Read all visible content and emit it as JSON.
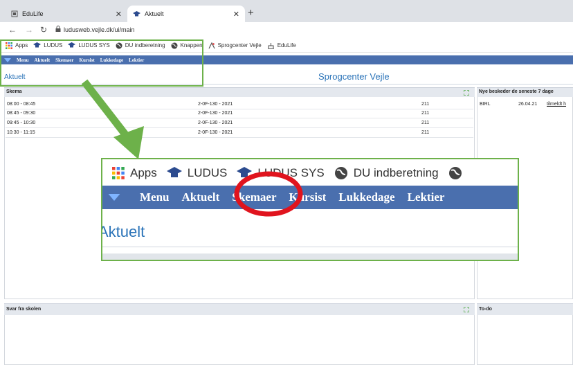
{
  "browser": {
    "tabs": [
      {
        "title": "EduLife",
        "active": false,
        "icon": "page-icon"
      },
      {
        "title": "Aktuelt",
        "active": true,
        "icon": "graduation-cap-icon"
      }
    ],
    "new_tab": "+",
    "url": "ludusweb.vejle.dk/ui/main",
    "bookmarks": [
      {
        "label": "Apps",
        "icon": "apps-grid-icon"
      },
      {
        "label": "LUDUS",
        "icon": "graduation-cap-icon"
      },
      {
        "label": "LUDUS SYS",
        "icon": "graduation-cap-icon"
      },
      {
        "label": "DU indberetning",
        "icon": "globe-icon"
      },
      {
        "label": "Knappen",
        "icon": "globe-icon"
      },
      {
        "label": "Sprogcenter Vejle",
        "icon": "sprogcenter-icon"
      },
      {
        "label": "EduLife",
        "icon": "edulife-icon"
      }
    ]
  },
  "app": {
    "menu": [
      "Menu",
      "Aktuelt",
      "Skemaer",
      "Kursist",
      "Lukkedage",
      "Lektier"
    ],
    "page_title": "Aktuelt",
    "center_title": "Sprogcenter Vejle",
    "schedule": {
      "title": "Skema",
      "rows": [
        {
          "time": "08:00 - 08:45",
          "course": "2-0F-130 - 2021",
          "room": "211"
        },
        {
          "time": "08:45 - 09:30",
          "course": "2-0F-130 - 2021",
          "room": "211"
        },
        {
          "time": "09:45 - 10:30",
          "course": "2-0F-130 - 2021",
          "room": "211"
        },
        {
          "time": "10:30 - 11:15",
          "course": "2-0F-130 - 2021",
          "room": "211"
        }
      ]
    },
    "messages": {
      "title": "Nye beskeder de seneste 7 dage",
      "rows": [
        {
          "from": "BIRL",
          "date": "26.04.21",
          "text": "tilmeldt h"
        }
      ]
    },
    "svar": {
      "title": "Svar fra skolen"
    },
    "todo": {
      "title": "To-do"
    }
  },
  "callout": {
    "bookmarks": [
      {
        "label": "Apps",
        "icon": "apps-grid-icon"
      },
      {
        "label": "LUDUS",
        "icon": "graduation-cap-icon"
      },
      {
        "label": "LUDUS SYS",
        "icon": "graduation-cap-icon"
      },
      {
        "label": "DU indberetning",
        "icon": "globe-icon"
      }
    ],
    "menu": [
      "Menu",
      "Aktuelt",
      "Skemaer",
      "Kursist",
      "Lukkedage",
      "Lektier"
    ],
    "page_title": "Aktuelt",
    "highlighted_item": "Skemaer"
  },
  "colors": {
    "menu_bg": "#4a6fae",
    "accent": "#2a73b8",
    "callout_green": "#6db14a",
    "highlight_red": "#e0141e"
  }
}
